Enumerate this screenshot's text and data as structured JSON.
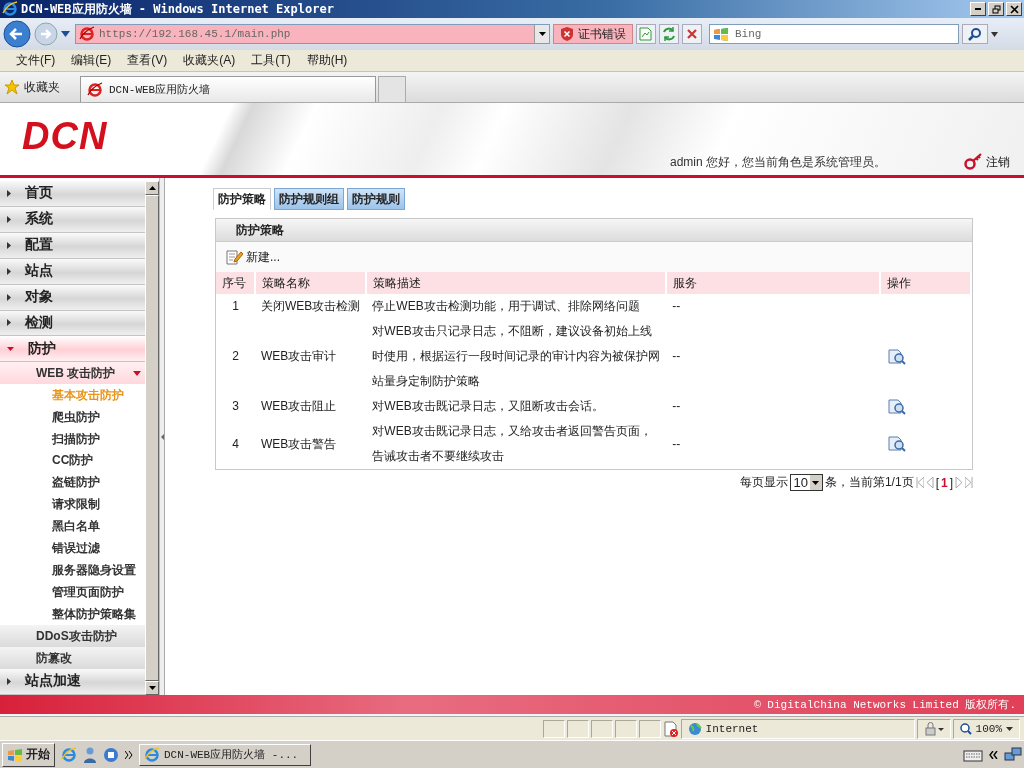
{
  "window": {
    "title": "DCN-WEB应用防火墙 - Windows Internet Explorer"
  },
  "address_bar": {
    "url": "https://192.168.45.1/main.php",
    "certificate_error": "证书错误"
  },
  "search": {
    "placeholder": "Bing"
  },
  "menu": [
    "文件(F)",
    "编辑(E)",
    "查看(V)",
    "收藏夹(A)",
    "工具(T)",
    "帮助(H)"
  ],
  "favorites_bar": {
    "label": "收藏夹",
    "tab": "DCN-WEB应用防火墙"
  },
  "header": {
    "logo": "DCN",
    "greeting": "admin 您好，您当前角色是系统管理员。",
    "logout": "注销"
  },
  "sidebar": {
    "items": [
      {
        "label": "首页",
        "expanded": false
      },
      {
        "label": "系统",
        "expanded": false
      },
      {
        "label": "配置",
        "expanded": false
      },
      {
        "label": "站点",
        "expanded": false
      },
      {
        "label": "对象",
        "expanded": false
      },
      {
        "label": "检测",
        "expanded": false
      },
      {
        "label": "防护",
        "expanded": true,
        "children": [
          {
            "label": "WEB 攻击防护",
            "expanded": true,
            "children": [
              {
                "label": "基本攻击防护",
                "selected": true
              },
              {
                "label": "爬虫防护",
                "selected": false
              },
              {
                "label": "扫描防护",
                "selected": false
              },
              {
                "label": "CC防护",
                "selected": false
              },
              {
                "label": "盗链防护",
                "selected": false
              },
              {
                "label": "请求限制",
                "selected": false
              },
              {
                "label": "黑白名单",
                "selected": false
              },
              {
                "label": "错误过滤",
                "selected": false
              },
              {
                "label": "服务器隐身设置",
                "selected": false
              },
              {
                "label": "管理页面防护",
                "selected": false
              },
              {
                "label": "整体防护策略集",
                "selected": false
              }
            ]
          },
          {
            "label": "DDoS攻击防护",
            "expanded": false
          },
          {
            "label": "防篡改",
            "expanded": false
          }
        ]
      },
      {
        "label": "站点加速",
        "expanded": false
      }
    ]
  },
  "tabs": [
    {
      "label": "防护策略",
      "selected": true
    },
    {
      "label": "防护规则组",
      "selected": false
    },
    {
      "label": "防护规则",
      "selected": false
    }
  ],
  "panel": {
    "title": "防护策略",
    "new_button": "新建...",
    "columns": [
      "序号",
      "策略名称",
      "策略描述",
      "服务",
      "操作"
    ],
    "rows": [
      {
        "index": "1",
        "name": "关闭WEB攻击检测",
        "description": "停止WEB攻击检测功能，用于调试、排除网络问题",
        "service": "--",
        "action_icon": false
      },
      {
        "index": "2",
        "name": "WEB攻击审计",
        "description": "对WEB攻击只记录日志，不阻断，建议设备初始上线时使用，根据运行一段时间记录的审计内容为被保护网站量身定制防护策略",
        "service": "--",
        "action_icon": true
      },
      {
        "index": "3",
        "name": "WEB攻击阻止",
        "description": "对WEB攻击既记录日志，又阻断攻击会话。",
        "service": "--",
        "action_icon": true
      },
      {
        "index": "4",
        "name": "WEB攻击警告",
        "description": "对WEB攻击既记录日志，又给攻击者返回警告页面，告诫攻击者不要继续攻击",
        "service": "--",
        "action_icon": true
      }
    ]
  },
  "pagination": {
    "per_page_label": "每页显示",
    "per_page": "10",
    "summary": "条，当前第1/1页",
    "page_open": "[",
    "current_page": "1",
    "page_close": "]"
  },
  "footer": {
    "copyright": "© DigitalChina Networks Limited 版权所有."
  },
  "status_bar": {
    "zone": "Internet",
    "zoom": "100%"
  },
  "taskbar": {
    "start": "开始",
    "task": "DCN-WEB应用防火墙 -..."
  }
}
